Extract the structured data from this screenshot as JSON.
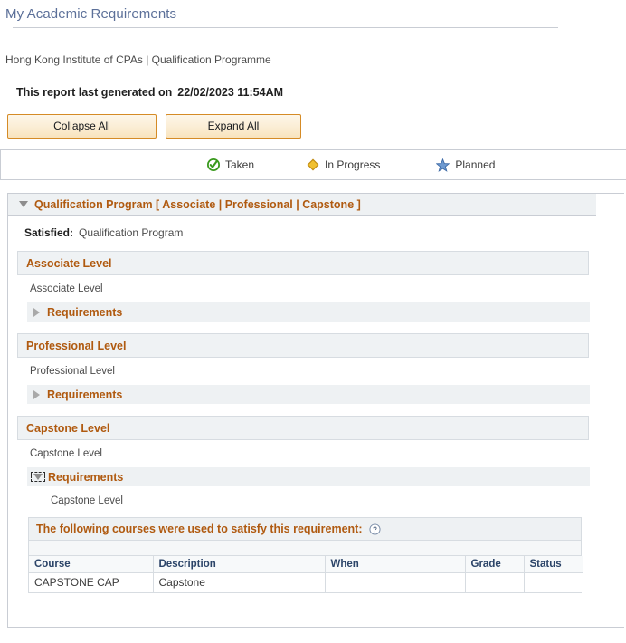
{
  "page": {
    "title": "My Academic Requirements",
    "institution_line": "Hong Kong Institute of CPAs | Qualification Programme",
    "report_generated_label": "This report last generated on",
    "report_generated_value": "22/02/2023 11:54AM"
  },
  "toolbar": {
    "collapse_all_label": "Collapse All",
    "expand_all_label": "Expand All"
  },
  "legend": {
    "items": [
      {
        "icon": "taken-check-icon",
        "label": "Taken",
        "color": "#3a9a1e"
      },
      {
        "icon": "in-progress-diamond-icon",
        "label": "In Progress",
        "color": "#e8b21c"
      },
      {
        "icon": "planned-star-icon",
        "label": "Planned",
        "color": "#4a7ebb"
      }
    ]
  },
  "program": {
    "header_title": "Qualification Program [ Associate | Professional | Capstone ]",
    "expander_state": "expanded",
    "satisfied_label": "Satisfied:",
    "satisfied_value": "Qualification Program",
    "levels": [
      {
        "bar_title": "Associate Level",
        "name": "Associate Level",
        "requirements_label": "Requirements",
        "requirements_state": "collapsed",
        "focused": false
      },
      {
        "bar_title": "Professional Level",
        "name": "Professional Level",
        "requirements_label": "Requirements",
        "requirements_state": "collapsed",
        "focused": false
      },
      {
        "bar_title": "Capstone Level",
        "name": "Capstone Level",
        "requirements_label": "Requirements",
        "requirements_state": "expanded",
        "focused": true
      }
    ]
  },
  "capstone_detail": {
    "sub_level_name": "Capstone Level",
    "caption": "The following courses were used to satisfy this requirement:",
    "help_icon": "help-question-icon",
    "columns": [
      "Course",
      "Description",
      "When",
      "Grade",
      "Status"
    ],
    "rows": [
      {
        "course": "CAPSTONE CAP",
        "description": "Capstone",
        "when": "",
        "grade": "",
        "status": ""
      }
    ]
  },
  "colors": {
    "accent_orange": "#b05a10",
    "title_blue": "#5c7099",
    "panel_grey": "#eef1f3",
    "border_grey": "#c9cdd4",
    "button_border": "#d58b26"
  }
}
